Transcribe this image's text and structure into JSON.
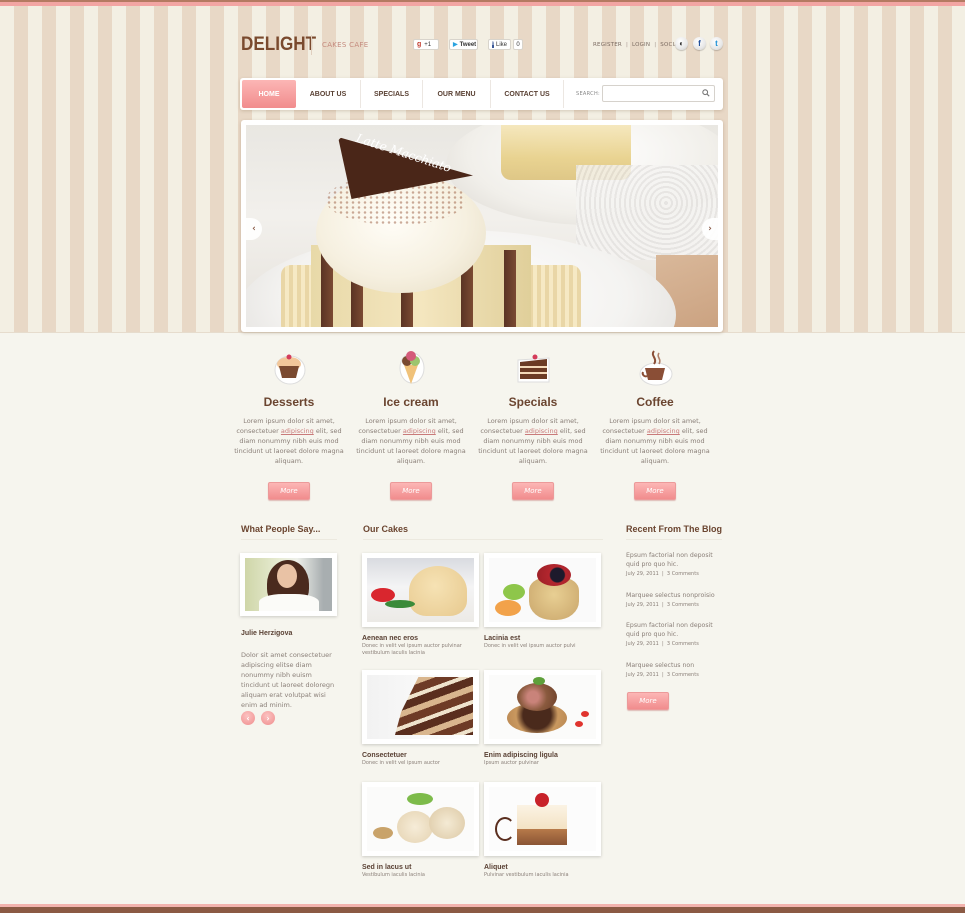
{
  "header": {
    "logo": "DELIGHT",
    "tagline": "CAKES CAFE",
    "social_buttons": {
      "gplus_label": "+1",
      "tweet_label": "Tweet",
      "like_label": "Like",
      "like_count": "0"
    },
    "top_links": [
      "REGISTER",
      "LOGIN",
      "SOCIAL"
    ],
    "top_link_separator": "|",
    "social_icons": [
      "delicious-icon",
      "facebook-icon",
      "twitter-icon"
    ]
  },
  "nav": {
    "items": [
      {
        "label": "HOME",
        "active": true
      },
      {
        "label": "ABOUT US",
        "active": false
      },
      {
        "label": "SPECIALS",
        "active": false
      },
      {
        "label": "OUR MENU",
        "active": false
      },
      {
        "label": "CONTACT US",
        "active": false
      }
    ],
    "search_label": "SEARCH:",
    "search_value": "",
    "search_placeholder": ""
  },
  "slider": {
    "caption": "Latte Macchiato",
    "prev_icon": "‹",
    "next_icon": "›"
  },
  "features": [
    {
      "title": "Desserts",
      "icon": "cupcake-icon",
      "text_before": "Lorem ipsum dolor sit amet, consectetuer ",
      "link": "adipiscing",
      "text_after": " elit, sed diam nonummy nibh euis mod tincidunt ut laoreet dolore magna aliquam.",
      "button": "More"
    },
    {
      "title": "Ice cream",
      "icon": "ice-cream-icon",
      "text_before": "Lorem ipsum dolor sit amet, consectetuer ",
      "link": "adipiscing",
      "text_after": " elit, sed diam nonummy nibh euis mod tincidunt ut laoreet dolore magna aliquam.",
      "button": "More"
    },
    {
      "title": "Specials",
      "icon": "cake-slice-icon",
      "text_before": "Lorem ipsum dolor sit amet, consectetuer ",
      "link": "adipiscing",
      "text_after": " elit, sed diam nonummy nibh euis mod tincidunt ut laoreet dolore magna aliquam.",
      "button": "More"
    },
    {
      "title": "Coffee",
      "icon": "coffee-cup-icon",
      "text_before": "Lorem ipsum dolor sit amet, consectetuer ",
      "link": "adipiscing",
      "text_after": " elit, sed diam nonummy nibh euis mod tincidunt ut laoreet dolore magna aliquam.",
      "button": "More"
    }
  ],
  "testimonials": {
    "title": "What  People Say...",
    "name": "Julie Herzigova",
    "text": "Dolor sit amet consectetuer adipiscing elitse diam nonummy nibh euism tincidunt ut laoreet doloregn aliquam erat volutpat wisi enim ad minim.",
    "prev_icon": "‹",
    "next_icon": "›"
  },
  "cakes": {
    "title": "Our Cakes",
    "items": [
      {
        "title": "Aenean nec eros",
        "desc": "Donec in velit vel ipsum auctor pulvinar vestibulum iaculis lacinia"
      },
      {
        "title": "Lacinia est",
        "desc": "Donec in velit vel ipsum auctor pulvi"
      },
      {
        "title": "Consectetuer",
        "desc": "Donec in velit vel ipsum auctor"
      },
      {
        "title": "Enim adipiscing ligula",
        "desc": "Ipsum auctor pulvinar"
      },
      {
        "title": "Sed in lacus ut",
        "desc": "Vestibulum iaculis lacinia"
      },
      {
        "title": "Aliquet",
        "desc": "Pulvinar vestibulum iaculis lacinia"
      }
    ]
  },
  "blog": {
    "title": "Recent From The Blog",
    "items": [
      {
        "title": "Epsum factorial non deposit quid pro quo hic.",
        "date": "July 29, 2011",
        "comments": "3 Comments"
      },
      {
        "title": "Marquee selectus nonproisio",
        "date": "July 29, 2011",
        "comments": "3 Comments"
      },
      {
        "title": "Epsum factorial non deposit quid pro quo hic.",
        "date": "July 29, 2011",
        "comments": "3 Comments"
      },
      {
        "title": "Marquee selectus non",
        "date": "July 29, 2011",
        "comments": "3 Comments"
      }
    ],
    "meta_separator": "|",
    "button": "More"
  },
  "colors": {
    "accent_pink": "#f18c8d",
    "brand_brown": "#7a4a2e",
    "background": "#f6f5ee"
  }
}
